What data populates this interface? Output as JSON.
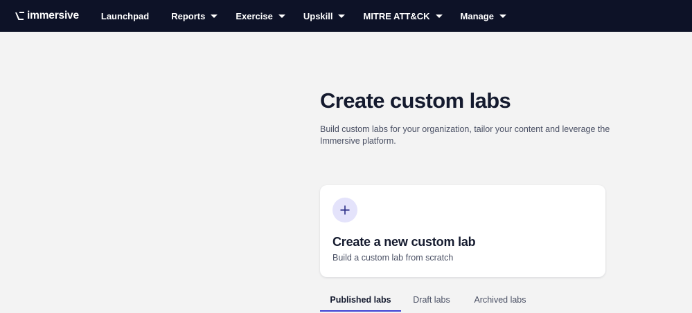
{
  "brand": {
    "name": "immersive"
  },
  "nav": {
    "items": [
      {
        "label": "Launchpad",
        "has_dropdown": false
      },
      {
        "label": "Reports",
        "has_dropdown": true
      },
      {
        "label": "Exercise",
        "has_dropdown": true
      },
      {
        "label": "Upskill",
        "has_dropdown": true
      },
      {
        "label": "MITRE ATT&CK",
        "has_dropdown": true
      },
      {
        "label": "Manage",
        "has_dropdown": true
      }
    ]
  },
  "main": {
    "title": "Create custom labs",
    "description": "Build custom labs for your organization, tailor your content and leverage the Immersive platform.",
    "create_card": {
      "icon": "plus-icon",
      "title": "Create a new custom lab",
      "subtitle": "Build a custom lab from scratch"
    },
    "tabs": [
      {
        "label": "Published labs",
        "active": true
      },
      {
        "label": "Draft labs",
        "active": false
      },
      {
        "label": "Archived labs",
        "active": false
      }
    ]
  },
  "colors": {
    "nav_bg": "#0d1227",
    "page_bg": "#f3f3f3",
    "accent": "#3b3fd4",
    "icon_bg": "#e4e3fb"
  }
}
